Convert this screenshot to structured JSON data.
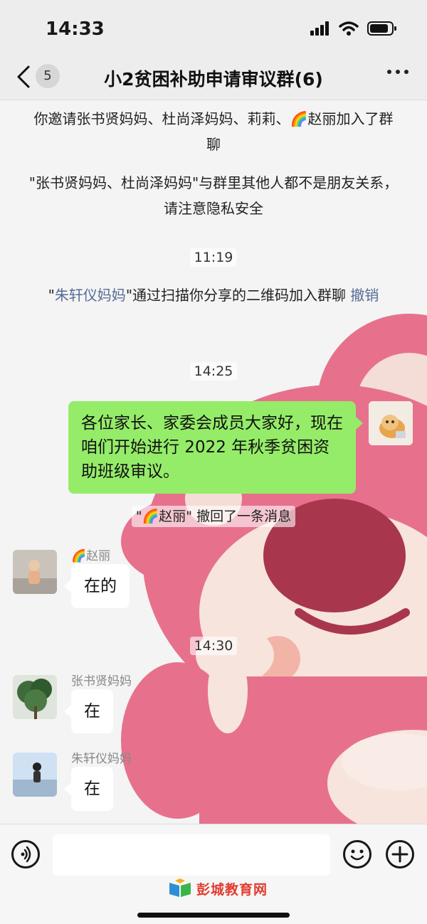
{
  "status_bar": {
    "time": "14:33"
  },
  "nav": {
    "badge_count": "5",
    "title": "小2贫困补助申请审议群(6)"
  },
  "system_messages": {
    "invite": "你邀请张书贤妈妈、杜尚泽妈妈、莉莉、🌈赵丽加入了群聊",
    "privacy": "\"张书贤妈妈、杜尚泽妈妈\"与群里其他人都不是朋友关系，请注意隐私安全",
    "qr_prefix": "\"",
    "qr_name": "朱轩仪妈妈",
    "qr_suffix": "\"通过扫描你分享的二维码加入群聊",
    "qr_action": "撤销"
  },
  "timestamps": [
    "11:19",
    "14:25",
    "14:30"
  ],
  "my_message": "各位家长、家委会成员大家好，现在咱们开始进行 2022 年秋季贫困资助班级审议。",
  "recall_notice": "\"🌈赵丽\" 撤回了一条消息",
  "messages": [
    {
      "sender": "🌈赵丽",
      "text": "在的"
    },
    {
      "sender": "张书贤妈妈",
      "text": "在"
    },
    {
      "sender": "朱轩仪妈妈",
      "text": "在"
    }
  ],
  "watermark": "彭城教育网",
  "colors": {
    "bubble_green": "#95ec69",
    "link": "#576b95",
    "bear_pink": "#e7718c",
    "bear_nose": "#a8374e"
  }
}
